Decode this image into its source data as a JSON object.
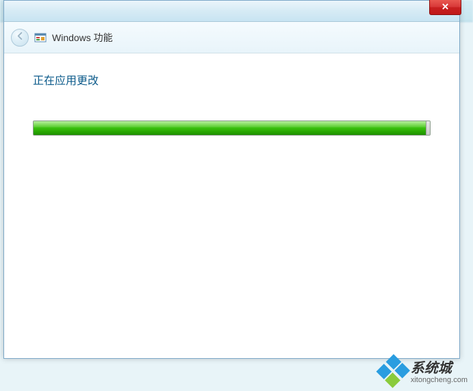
{
  "window": {
    "title": "Windows 功能"
  },
  "content": {
    "status": "正在应用更改",
    "progress_percent": 99
  },
  "watermark": {
    "title": "系统城",
    "url": "xitongcheng.com"
  }
}
